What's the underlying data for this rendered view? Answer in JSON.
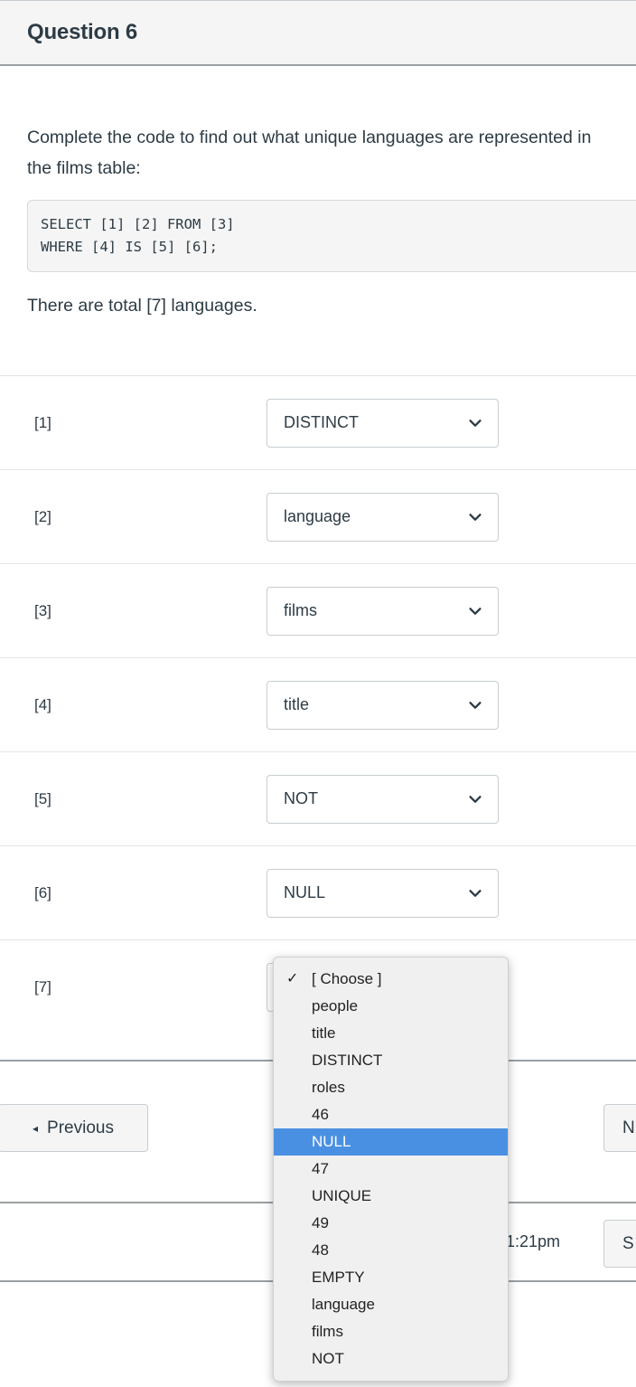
{
  "header": {
    "title": "Question 6"
  },
  "question": {
    "prompt": "Complete the code to find out what unique languages are represented in the films table:",
    "code": "SELECT [1] [2] FROM [3]\nWHERE [4] IS [5] [6];",
    "after_text": "There are total [7] languages."
  },
  "answers": [
    {
      "label": "[1]",
      "value": "DISTINCT"
    },
    {
      "label": "[2]",
      "value": "language"
    },
    {
      "label": "[3]",
      "value": "films"
    },
    {
      "label": "[4]",
      "value": "title"
    },
    {
      "label": "[5]",
      "value": "NOT"
    },
    {
      "label": "[6]",
      "value": "NULL"
    },
    {
      "label": "[7]",
      "value": ""
    }
  ],
  "dropdown": {
    "open_for": "[7]",
    "highlight_color": "#4a90e2",
    "checked_option": "[ Choose ]",
    "highlighted_option": "NULL",
    "options": [
      "[ Choose ]",
      "people",
      "title",
      "DISTINCT",
      "roles",
      "46",
      "NULL",
      "47",
      "UNIQUE",
      "49",
      "48",
      "EMPTY",
      "language",
      "films",
      "NOT"
    ]
  },
  "footer": {
    "previous_label": "Previous",
    "previous_arrow": "◂",
    "next_label": "N",
    "saved_time": "1:21pm",
    "submit_label": "S"
  },
  "icons": {
    "check": "✓",
    "chevron_down": "chevron-down-icon"
  }
}
